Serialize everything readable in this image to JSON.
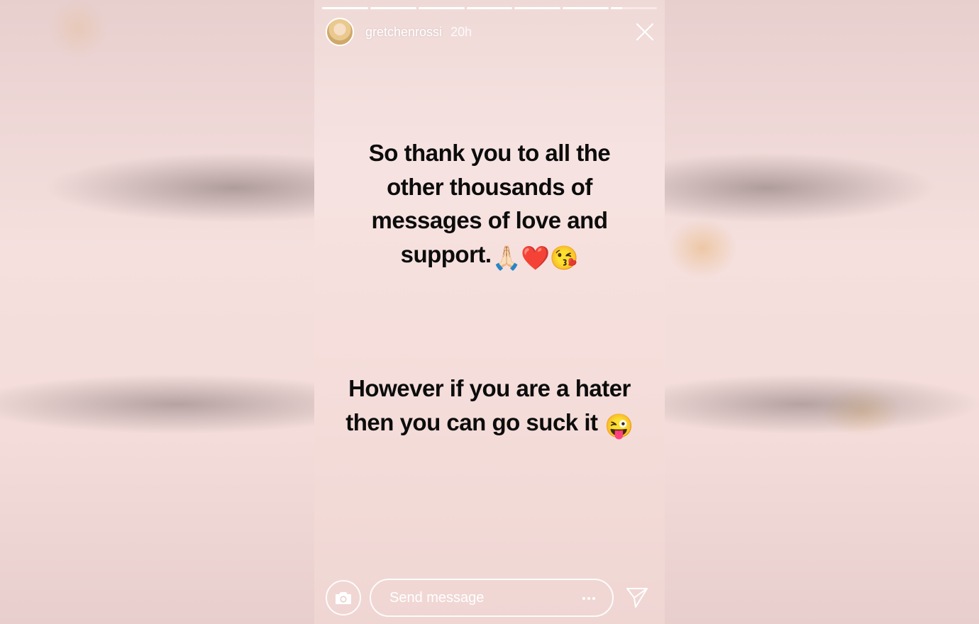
{
  "story": {
    "progress": {
      "segment_count": 7,
      "fills": [
        1,
        1,
        1,
        1,
        1,
        1,
        0.25
      ]
    },
    "header": {
      "username": "gretchenrossi",
      "time_ago": "20h",
      "avatar_icon": "profile-photo"
    },
    "message": {
      "line_1": "So thank you to all the",
      "line_2": "other thousands of",
      "line_3": "messages of love and",
      "line_4": "support.",
      "line_4_emojis": "🙏🏻❤️😘",
      "line_5": "However if you are a hater",
      "line_6": "then you can go suck it",
      "line_6_emoji": "😜"
    },
    "footer": {
      "camera_icon": "camera-icon",
      "input_placeholder": "Send message",
      "more_icon": "more-dots-icon",
      "send_icon": "paper-plane-icon"
    },
    "colors": {
      "text": "#0c0c0c",
      "background": "#f5dfdd",
      "ui": "#ffffff"
    }
  }
}
